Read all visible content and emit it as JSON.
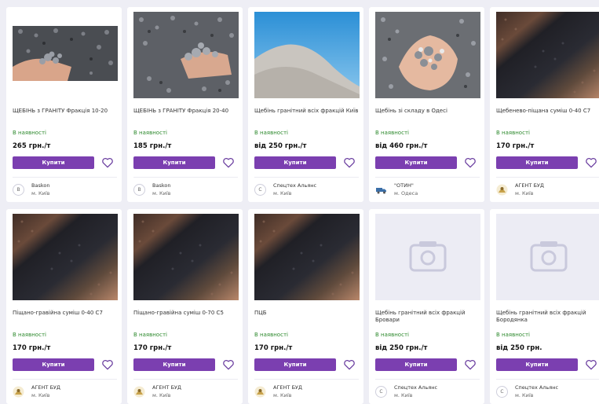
{
  "products": [
    {
      "title": "ЩЕБІНЬ з ГРАНІТУ Фракція 10-20",
      "availability": "В наявності",
      "price": "265 грн./т",
      "buy_label": "Купити",
      "seller": "Baskon",
      "city": "м. Київ",
      "image_type": "gravel-hand",
      "avatar_type": "letter",
      "avatar_letter": "B"
    },
    {
      "title": "ЩЕБІНЬ з ГРАНІТУ Фракція 20-40",
      "availability": "В наявності",
      "price": "185 грн./т",
      "buy_label": "Купити",
      "seller": "Baskon",
      "city": "м. Київ",
      "image_type": "gravel-pile",
      "avatar_type": "letter",
      "avatar_letter": "B"
    },
    {
      "title": "Щебінь гранітний всіх фракцій Київ",
      "availability": "В наявності",
      "price": "від 250 грн./т",
      "buy_label": "Купити",
      "seller": "Спецтех Альянс",
      "city": "м. Київ",
      "image_type": "sand-sky",
      "avatar_type": "letter",
      "avatar_letter": "С"
    },
    {
      "title": "Щебінь зі складу в Одесі",
      "availability": "В наявності",
      "price": "від 460 грн./т",
      "buy_label": "Купити",
      "seller": "\"ОТИН\"",
      "city": "м. Одеса",
      "image_type": "gravel-hand2",
      "avatar_type": "truck",
      "avatar_letter": ""
    },
    {
      "title": "Щебенево-піщана суміш 0-40 С7",
      "availability": "В наявності",
      "price": "170 грн./т",
      "buy_label": "Купити",
      "seller": "АГЕНТ БУД",
      "city": "м. Київ",
      "image_type": "mix",
      "avatar_type": "agent",
      "avatar_letter": ""
    },
    {
      "title": "Піщано-гравійна суміш 0-40 С7",
      "availability": "В наявності",
      "price": "170 грн./т",
      "buy_label": "Купити",
      "seller": "АГЕНТ БУД",
      "city": "м. Київ",
      "image_type": "mix",
      "avatar_type": "agent",
      "avatar_letter": ""
    },
    {
      "title": "Піщано-гравійна суміш 0-70 С5",
      "availability": "В наявності",
      "price": "170 грн./т",
      "buy_label": "Купити",
      "seller": "АГЕНТ БУД",
      "city": "м. Київ",
      "image_type": "mix",
      "avatar_type": "agent",
      "avatar_letter": ""
    },
    {
      "title": "ПЦБ",
      "availability": "В наявності",
      "price": "170 грн./т",
      "buy_label": "Купити",
      "seller": "АГЕНТ БУД",
      "city": "м. Київ",
      "image_type": "mix",
      "avatar_type": "agent",
      "avatar_letter": ""
    },
    {
      "title": "Щебінь гранітний всіх фракцій Бровари",
      "availability": "В наявності",
      "price": "від 250 грн./т",
      "buy_label": "Купити",
      "seller": "Спецтех Альянс",
      "city": "м. Київ",
      "image_type": "placeholder",
      "avatar_type": "letter",
      "avatar_letter": "С"
    },
    {
      "title": "Щебінь гранітний всіх фракцій Бородянка",
      "availability": "В наявності",
      "price": "від 250 грн.",
      "buy_label": "Купити",
      "seller": "Спецтех Альянс",
      "city": "м. Київ",
      "image_type": "placeholder",
      "avatar_type": "letter",
      "avatar_letter": "С"
    }
  ],
  "colors": {
    "buy_button": "#7b3fb0",
    "availability": "#2e8a2e",
    "heart": "#6b3fa0",
    "placeholder_bg": "#ececf4",
    "placeholder_icon": "#c9c9dc"
  }
}
